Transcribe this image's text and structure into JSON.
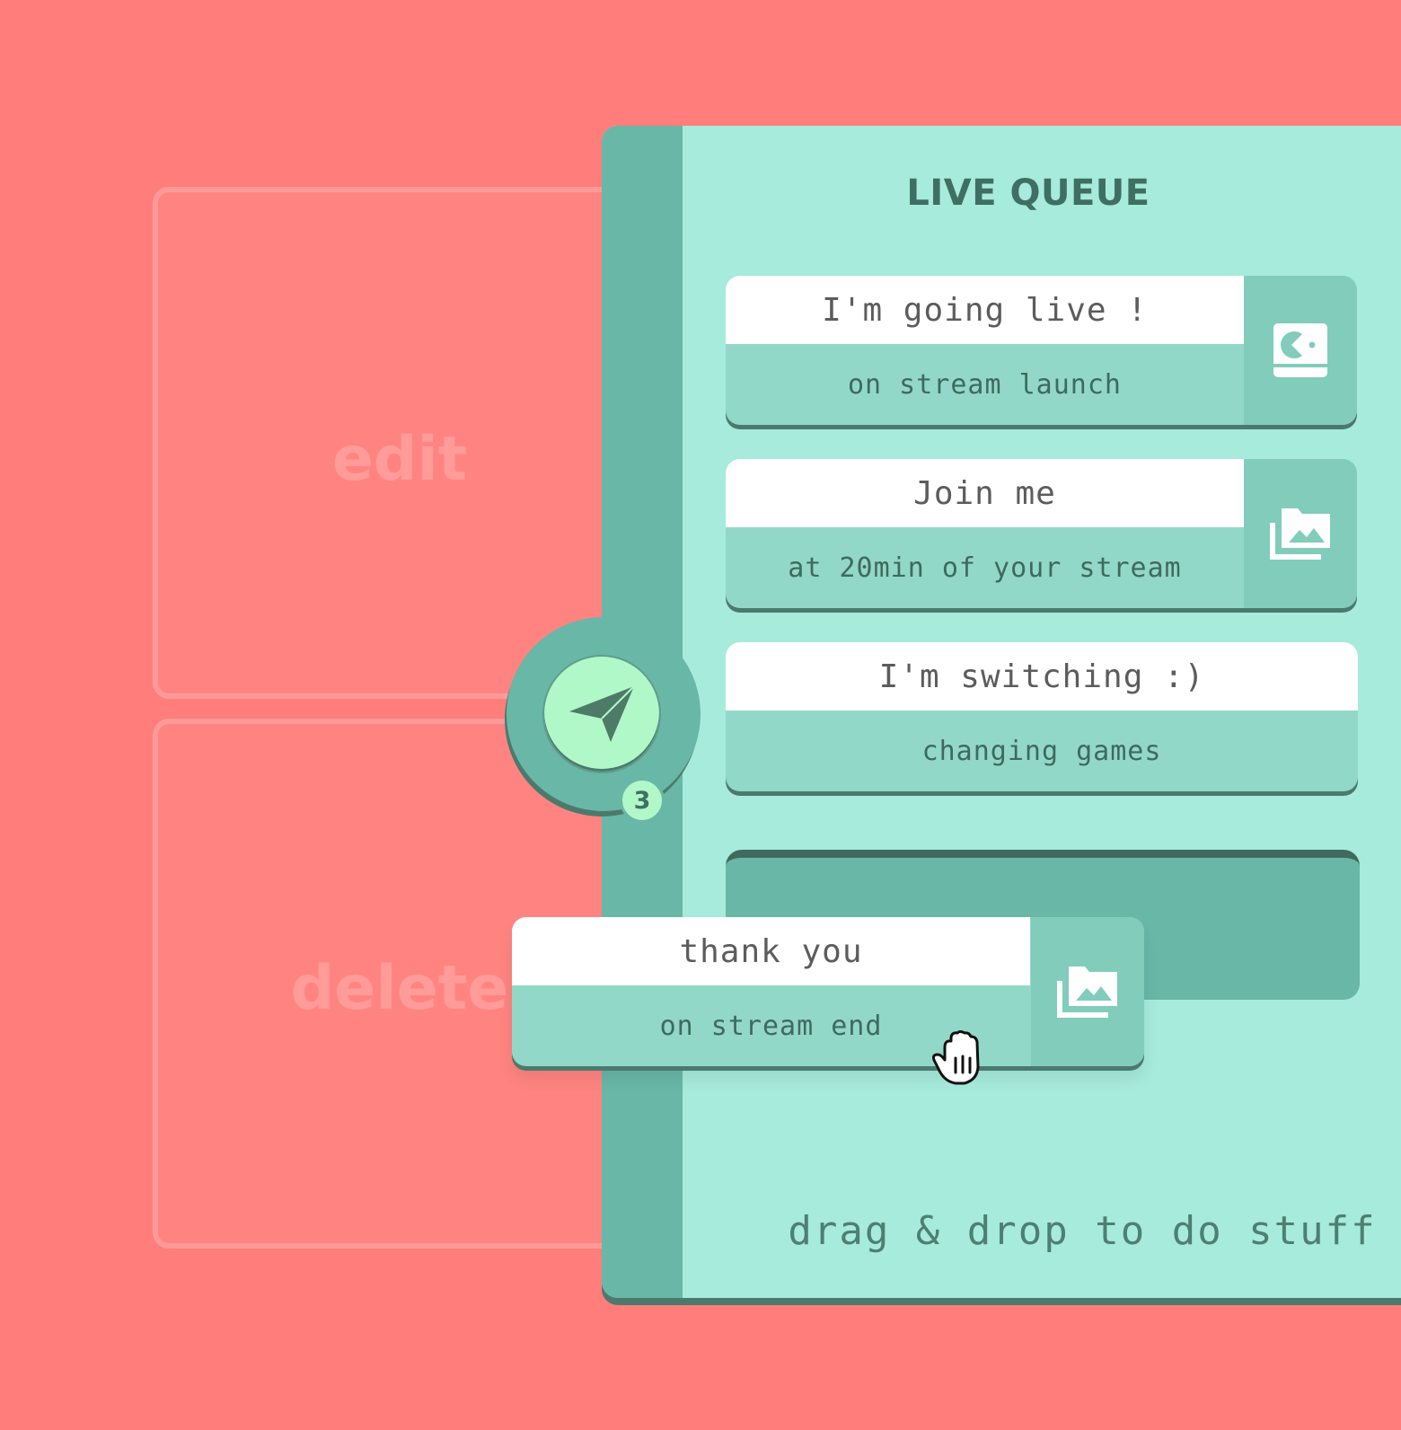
{
  "zones": {
    "edit_label": "edit",
    "delete_label": "delete"
  },
  "queue": {
    "title": "LIVE QUEUE",
    "count": "3",
    "items": [
      {
        "title": "I'm going live !",
        "trigger": "on stream launch",
        "icon": "game-icon"
      },
      {
        "title": "Join me",
        "trigger": "at 20min of your stream",
        "icon": "gallery-icon"
      },
      {
        "title": "I'm switching :)",
        "trigger": "changing games",
        "icon": null
      }
    ],
    "dragging": {
      "title": "thank you",
      "trigger": "on stream end",
      "icon": "gallery-icon"
    },
    "hint": "drag & drop to do stuff"
  },
  "colors": {
    "background": "#ff7d7a",
    "panel": "#a6ebdc",
    "rail": "#69b7a7",
    "send_button": "#b1f8c9",
    "title": "#3f6f62"
  }
}
